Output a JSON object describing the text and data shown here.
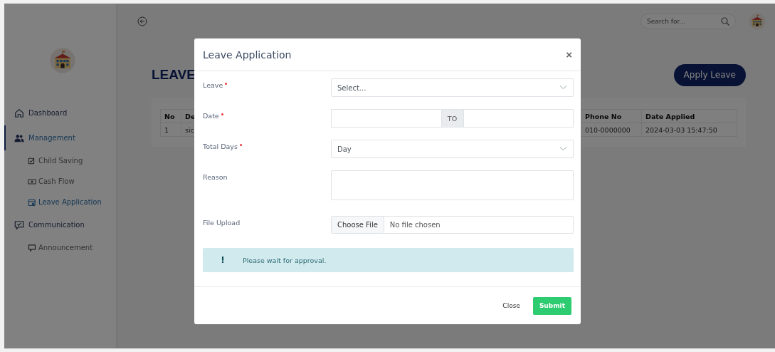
{
  "sidebar": {
    "items": [
      {
        "label": "Dashboard",
        "kind": "section",
        "selected": false
      },
      {
        "label": "Management",
        "kind": "section",
        "selected": true
      },
      {
        "label": "Child Saving",
        "kind": "sub",
        "selected": false
      },
      {
        "label": "Cash Flow",
        "kind": "sub",
        "selected": false
      },
      {
        "label": "Leave Application",
        "kind": "sub",
        "selected": true
      },
      {
        "label": "Communication",
        "kind": "section",
        "selected": false
      },
      {
        "label": "Announcement",
        "kind": "sub",
        "selected": false
      }
    ]
  },
  "topbar": {
    "search": {
      "placeholder": "Search for..."
    }
  },
  "page": {
    "heading": "LEAVE",
    "action_button": "Apply Leave",
    "table": {
      "columns": [
        "No",
        "De",
        "Phone No",
        "Date Applied"
      ],
      "rows": [
        [
          "1",
          "sic",
          "010-0000000",
          "2024-03-03 15:47:50"
        ]
      ]
    }
  },
  "modal": {
    "title": "Leave Application",
    "close_symbol": "×",
    "fields": [
      {
        "kind": "select",
        "label": "Leave",
        "required": true,
        "value": "Select..."
      },
      {
        "kind": "date_range",
        "label": "Date",
        "required": true,
        "separator": "TO"
      },
      {
        "kind": "select",
        "label": "Total Days",
        "required": true,
        "value": "Day"
      },
      {
        "kind": "textarea",
        "label": "Reason",
        "required": false
      },
      {
        "kind": "file",
        "label": "File Upload",
        "required": false,
        "button": "Choose File",
        "status": "No file chosen"
      }
    ],
    "alert": {
      "symbol": "!",
      "text": "Please wait for approval."
    },
    "buttons": [
      {
        "label": "Close",
        "kind": "plain"
      },
      {
        "label": "Submit",
        "kind": "primary"
      }
    ]
  }
}
